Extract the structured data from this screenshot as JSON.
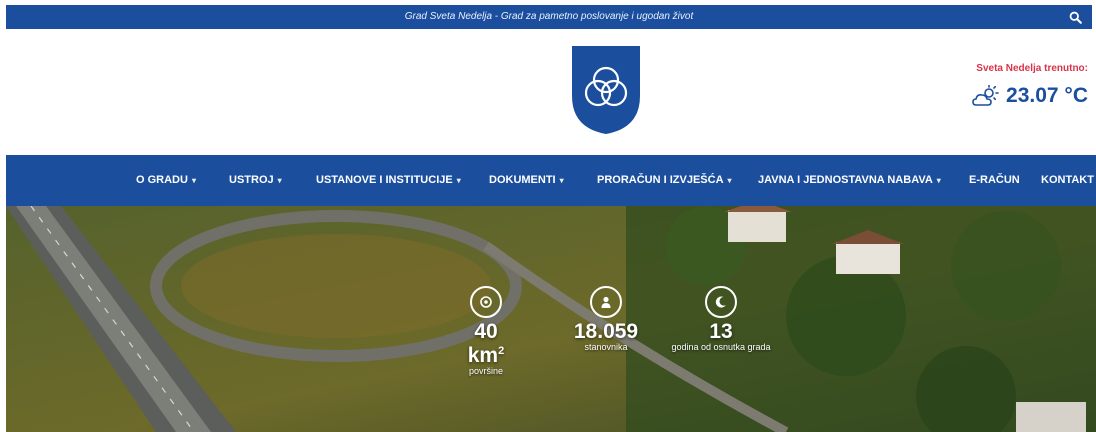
{
  "topbar": {
    "tagline": "Grad Sveta Nedelja - Grad za pametno poslovanje i ugodan život",
    "search_icon": "search-icon"
  },
  "header": {
    "logo_icon": "city-crest-icon",
    "weather": {
      "label": "Sveta Nedelja trenutno:",
      "icon": "partly-cloudy-icon",
      "temperature": "23.07 °C"
    }
  },
  "nav": {
    "items": [
      {
        "label": "O GRADU",
        "dropdown": true
      },
      {
        "label": "USTROJ",
        "dropdown": true
      },
      {
        "label": "USTANOVE I INSTITUCIJE",
        "dropdown": true
      },
      {
        "label": "DOKUMENTI",
        "dropdown": true
      },
      {
        "label": "PRORAČUN I IZVJEŠĆA",
        "dropdown": true
      },
      {
        "label": "JAVNA I JEDNOSTAVNA NABAVA",
        "dropdown": true
      },
      {
        "label": "E-RAČUN",
        "dropdown": false
      },
      {
        "label": "KONTAKT",
        "dropdown": false
      }
    ],
    "caret": "▾"
  },
  "hero": {
    "stats": [
      {
        "icon": "target-icon",
        "value": "40 km",
        "sup": "2",
        "caption": "površine"
      },
      {
        "icon": "person-icon",
        "value": "18.059",
        "sup": "",
        "caption": "stanovnika"
      },
      {
        "icon": "moon-icon",
        "value": "13",
        "sup": "",
        "caption": "godina od osnutka grada"
      }
    ]
  },
  "colors": {
    "brand": "#1b4f9e",
    "accent": "#d9334a"
  }
}
